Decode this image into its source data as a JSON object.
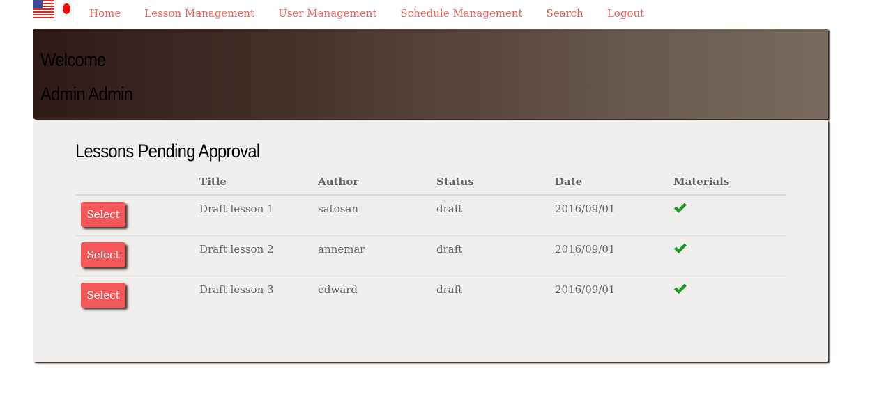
{
  "nav": {
    "flags": [
      {
        "name": "us-flag-icon",
        "label": "English"
      },
      {
        "name": "japan-flag-icon",
        "label": "Japanese"
      }
    ],
    "links": [
      "Home",
      "Lesson Management",
      "User Management",
      "Schedule Management",
      "Search",
      "Logout"
    ],
    "link_color": "#f05a57"
  },
  "hero": {
    "line1": "Welcome",
    "line2": "Admin Admin"
  },
  "lessons": {
    "title": "Lessons Pending Approval",
    "columns": [
      "",
      "Title",
      "Author",
      "Status",
      "Date",
      "Materials"
    ],
    "rows": [
      {
        "button": "Select",
        "title": "Draft lesson 1",
        "author": "satosan",
        "status": "draft",
        "date": "2016/09/01",
        "materials": "check-icon"
      },
      {
        "button": "Select",
        "title": "Draft lesson 2",
        "author": "annemar",
        "status": "draft",
        "date": "2016/09/01",
        "materials": "check-icon"
      },
      {
        "button": "Select",
        "title": "Draft lesson 3",
        "author": "edward",
        "status": "draft",
        "date": "2016/09/01",
        "materials": "check-icon"
      }
    ],
    "button_color": "#f5585a",
    "check_color": "#1a9a1a"
  }
}
